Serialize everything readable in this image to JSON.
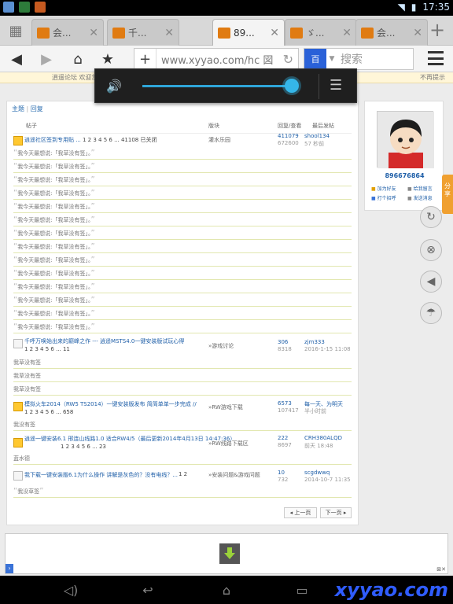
{
  "status_bar": {
    "time": "17:35"
  },
  "tabs": [
    {
      "title": "会..."
    },
    {
      "title": "千..."
    },
    {
      "title": "89..."
    },
    {
      "title": "ゞ..."
    },
    {
      "title": "会..."
    }
  ],
  "toolbar": {
    "url": "www.xyyao.com/hc 図",
    "search_placeholder": "搜索"
  },
  "notice": {
    "text": "逍遥论坛 欢迎您前",
    "right": "不再提示"
  },
  "breadcrumb": {
    "a": "主题",
    "sep": "|",
    "b": "回复"
  },
  "table_head": {
    "thread": "帖子",
    "board": "版块",
    "stats": "回复/查看",
    "last": "最后发帖"
  },
  "threads": [
    {
      "title": "逍遥社区签到专用贴 ...",
      "pages": "1  2  3  4  5  6 ... 41108  已关闭",
      "board": "灌水乐园",
      "replies": "411079",
      "views": "672600",
      "author": "shool134",
      "date": "57 秒前",
      "reply_lines": [
        "我今天最想说:「我草没有签」。",
        "我今天最想说:「我草没有签」。",
        "我今天最想说:「我草没有签」。",
        "我今天最想说:「我草没有签」。",
        "我今天最想说:「我草没有签」。",
        "我今天最想说:「我草没有签」。",
        "我今天最想说:「我草没有签」。",
        "我今天最想说:「我草没有签」。",
        "我今天最想说:「我草没有签」。",
        "我今天最想说:「我草没有签」。",
        "我今天最想说:「我草没有签」。",
        "我今天最想说:「我草没有签」。",
        "我今天最想说:「我草没有签」。",
        "我今天最想说:「我草没有签」。"
      ]
    },
    {
      "title": "千呼万唤始出来的巅峰之作 --- 逍遥MSTS4.0一键安装版试玩心得",
      "pages": "1  2  3  4  5  6 ... 11",
      "board": "»游戏讨论",
      "replies": "306",
      "views": "8318",
      "author": "zjm333",
      "date": "2016-1-15 11:08",
      "reply_lines": [
        "我草没有签",
        "我草没有签",
        "我草没有签"
      ]
    },
    {
      "title": "模拟火车2014（RW5 TS2014）一键安装版发布 简简单单一步完成 //",
      "pages": "1  2  3  4  5  6 ... 658",
      "board": "»RW游戏下载",
      "replies": "6573",
      "views": "107417",
      "author": "每一天、为明天",
      "date": "半小时前",
      "reply_lines": [
        "我没有签"
      ]
    },
    {
      "title": "逍遥一键安装6.1 邢连山线路1.0 适合RW4/5（最后更新2014年4月13日 14:47:36）",
      "pages": "1  2  3  4  5  6 ... 23",
      "board": "»RW线路下载区",
      "replies": "222",
      "views": "8697",
      "author": "CRH380ALQD",
      "date": "前天 18:48",
      "reply_lines": [
        "蓝水德"
      ]
    },
    {
      "title": "我下载一键安装版6.1为什么操作 讲解是灰色的？没有电线？...",
      "pages": "1  2",
      "board": "»安装问题&游戏问题",
      "replies": "10",
      "views": "732",
      "author": "scgdwwq",
      "date": "2014-10-7 11:35",
      "reply_lines": [
        "我没草签"
      ]
    }
  ],
  "pager": {
    "prev": "◂ 上一页",
    "next": "下一页 ▸"
  },
  "profile": {
    "username": "896676864",
    "links": [
      "加为好友",
      "给我留言",
      "打个招呼",
      "发送消息"
    ]
  },
  "share_label": "分享",
  "volume": {
    "level": 0.95
  },
  "watermark": "xyyao.com",
  "colors": {
    "link": "#1f5fa8",
    "accent": "#35b6e8",
    "share": "#f0a030"
  }
}
